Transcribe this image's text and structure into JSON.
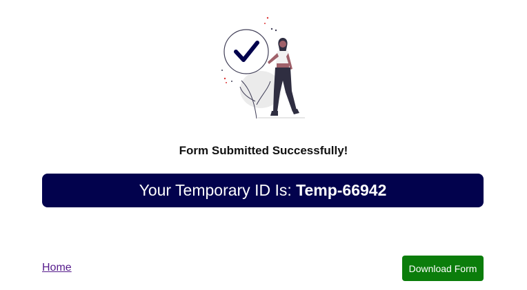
{
  "illustration": {
    "icon": "checkmark-circle-with-person",
    "accent_color": "#02024d"
  },
  "status": {
    "title": "Form Submitted Successfully!"
  },
  "banner": {
    "label": "Your Temporary ID Is: ",
    "id_value": "Temp-66942",
    "background_color": "#02024d"
  },
  "footer": {
    "home_link": "Home",
    "download_button": "Download Form",
    "button_color": "#0b7d0b",
    "link_color": "#551a8b"
  }
}
